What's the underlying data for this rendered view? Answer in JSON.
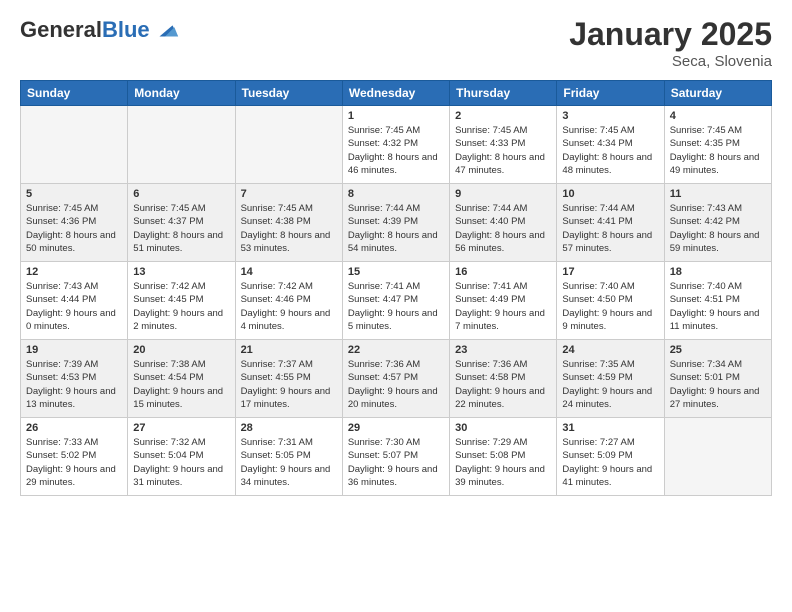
{
  "logo": {
    "general": "General",
    "blue": "Blue"
  },
  "header": {
    "month": "January 2025",
    "location": "Seca, Slovenia"
  },
  "weekdays": [
    "Sunday",
    "Monday",
    "Tuesday",
    "Wednesday",
    "Thursday",
    "Friday",
    "Saturday"
  ],
  "weeks": [
    [
      {
        "day": "",
        "empty": true
      },
      {
        "day": "",
        "empty": true
      },
      {
        "day": "",
        "empty": true
      },
      {
        "day": "1",
        "sunrise": "7:45 AM",
        "sunset": "4:32 PM",
        "daylight": "8 hours and 46 minutes."
      },
      {
        "day": "2",
        "sunrise": "7:45 AM",
        "sunset": "4:33 PM",
        "daylight": "8 hours and 47 minutes."
      },
      {
        "day": "3",
        "sunrise": "7:45 AM",
        "sunset": "4:34 PM",
        "daylight": "8 hours and 48 minutes."
      },
      {
        "day": "4",
        "sunrise": "7:45 AM",
        "sunset": "4:35 PM",
        "daylight": "8 hours and 49 minutes."
      }
    ],
    [
      {
        "day": "5",
        "sunrise": "7:45 AM",
        "sunset": "4:36 PM",
        "daylight": "8 hours and 50 minutes."
      },
      {
        "day": "6",
        "sunrise": "7:45 AM",
        "sunset": "4:37 PM",
        "daylight": "8 hours and 51 minutes."
      },
      {
        "day": "7",
        "sunrise": "7:45 AM",
        "sunset": "4:38 PM",
        "daylight": "8 hours and 53 minutes."
      },
      {
        "day": "8",
        "sunrise": "7:44 AM",
        "sunset": "4:39 PM",
        "daylight": "8 hours and 54 minutes."
      },
      {
        "day": "9",
        "sunrise": "7:44 AM",
        "sunset": "4:40 PM",
        "daylight": "8 hours and 56 minutes."
      },
      {
        "day": "10",
        "sunrise": "7:44 AM",
        "sunset": "4:41 PM",
        "daylight": "8 hours and 57 minutes."
      },
      {
        "day": "11",
        "sunrise": "7:43 AM",
        "sunset": "4:42 PM",
        "daylight": "8 hours and 59 minutes."
      }
    ],
    [
      {
        "day": "12",
        "sunrise": "7:43 AM",
        "sunset": "4:44 PM",
        "daylight": "9 hours and 0 minutes."
      },
      {
        "day": "13",
        "sunrise": "7:42 AM",
        "sunset": "4:45 PM",
        "daylight": "9 hours and 2 minutes."
      },
      {
        "day": "14",
        "sunrise": "7:42 AM",
        "sunset": "4:46 PM",
        "daylight": "9 hours and 4 minutes."
      },
      {
        "day": "15",
        "sunrise": "7:41 AM",
        "sunset": "4:47 PM",
        "daylight": "9 hours and 5 minutes."
      },
      {
        "day": "16",
        "sunrise": "7:41 AM",
        "sunset": "4:49 PM",
        "daylight": "9 hours and 7 minutes."
      },
      {
        "day": "17",
        "sunrise": "7:40 AM",
        "sunset": "4:50 PM",
        "daylight": "9 hours and 9 minutes."
      },
      {
        "day": "18",
        "sunrise": "7:40 AM",
        "sunset": "4:51 PM",
        "daylight": "9 hours and 11 minutes."
      }
    ],
    [
      {
        "day": "19",
        "sunrise": "7:39 AM",
        "sunset": "4:53 PM",
        "daylight": "9 hours and 13 minutes."
      },
      {
        "day": "20",
        "sunrise": "7:38 AM",
        "sunset": "4:54 PM",
        "daylight": "9 hours and 15 minutes."
      },
      {
        "day": "21",
        "sunrise": "7:37 AM",
        "sunset": "4:55 PM",
        "daylight": "9 hours and 17 minutes."
      },
      {
        "day": "22",
        "sunrise": "7:36 AM",
        "sunset": "4:57 PM",
        "daylight": "9 hours and 20 minutes."
      },
      {
        "day": "23",
        "sunrise": "7:36 AM",
        "sunset": "4:58 PM",
        "daylight": "9 hours and 22 minutes."
      },
      {
        "day": "24",
        "sunrise": "7:35 AM",
        "sunset": "4:59 PM",
        "daylight": "9 hours and 24 minutes."
      },
      {
        "day": "25",
        "sunrise": "7:34 AM",
        "sunset": "5:01 PM",
        "daylight": "9 hours and 27 minutes."
      }
    ],
    [
      {
        "day": "26",
        "sunrise": "7:33 AM",
        "sunset": "5:02 PM",
        "daylight": "9 hours and 29 minutes."
      },
      {
        "day": "27",
        "sunrise": "7:32 AM",
        "sunset": "5:04 PM",
        "daylight": "9 hours and 31 minutes."
      },
      {
        "day": "28",
        "sunrise": "7:31 AM",
        "sunset": "5:05 PM",
        "daylight": "9 hours and 34 minutes."
      },
      {
        "day": "29",
        "sunrise": "7:30 AM",
        "sunset": "5:07 PM",
        "daylight": "9 hours and 36 minutes."
      },
      {
        "day": "30",
        "sunrise": "7:29 AM",
        "sunset": "5:08 PM",
        "daylight": "9 hours and 39 minutes."
      },
      {
        "day": "31",
        "sunrise": "7:27 AM",
        "sunset": "5:09 PM",
        "daylight": "9 hours and 41 minutes."
      },
      {
        "day": "",
        "empty": true
      }
    ]
  ]
}
